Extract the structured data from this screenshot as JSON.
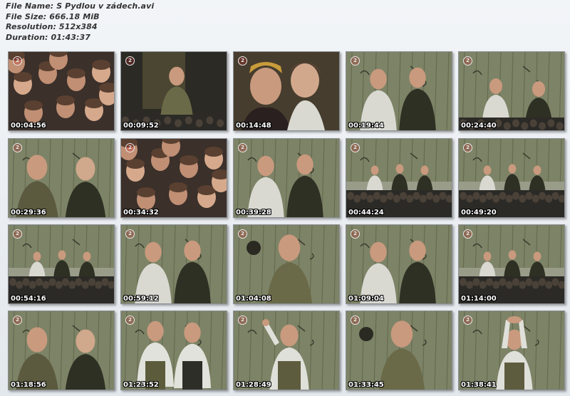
{
  "header": {
    "file_name": "File Name: S Pydlou v zádech.avi",
    "file_size": "File Size: 666.18 MiB",
    "resolution": "Resolution: 512x384",
    "duration": "Duration: 01:43:37"
  },
  "thumbnails": [
    {
      "time": "00:04:56",
      "scene": "audience-closeup"
    },
    {
      "time": "00:09:52",
      "scene": "actor-standing-dark"
    },
    {
      "time": "00:14:48",
      "scene": "two-faces-closeup"
    },
    {
      "time": "00:19:44",
      "scene": "two-actors-wall"
    },
    {
      "time": "00:24:40",
      "scene": "two-actors-wide"
    },
    {
      "time": "00:29:36",
      "scene": "two-actors-closeup"
    },
    {
      "time": "00:34:32",
      "scene": "audience-closeup"
    },
    {
      "time": "00:39:28",
      "scene": "two-actors-wall"
    },
    {
      "time": "00:44:24",
      "scene": "stage-wide-audience"
    },
    {
      "time": "00:49:20",
      "scene": "stage-wide-audience"
    },
    {
      "time": "00:54:16",
      "scene": "stage-wide-audience"
    },
    {
      "time": "00:59:12",
      "scene": "two-actors-wall"
    },
    {
      "time": "01:04:08",
      "scene": "single-actor-wall"
    },
    {
      "time": "01:09:04",
      "scene": "two-actors-wall"
    },
    {
      "time": "01:14:00",
      "scene": "stage-wide-audience"
    },
    {
      "time": "01:18:56",
      "scene": "two-actors-closeup"
    },
    {
      "time": "01:23:52",
      "scene": "two-actors-standing"
    },
    {
      "time": "01:28:49",
      "scene": "single-actor-arm-raised"
    },
    {
      "time": "01:33:45",
      "scene": "single-actor-wall"
    },
    {
      "time": "01:38:41",
      "scene": "single-actor-arms-up"
    }
  ],
  "logo_text": "2",
  "colors": {
    "wall": "#7d8366",
    "wall_dark": "#4f5440",
    "audience": "#2c2a26",
    "skin": "#c99a7e",
    "dark_clothes": "#2e3024",
    "light_clothes": "#d9d9d2"
  }
}
